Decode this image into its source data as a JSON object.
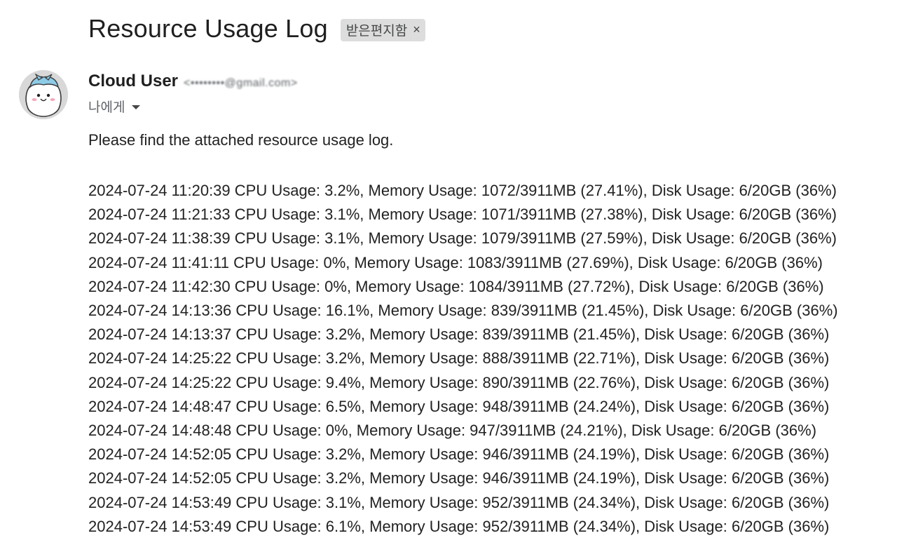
{
  "email": {
    "subject": "Resource Usage Log",
    "label_chip": {
      "label": "받은편지함",
      "close": "×"
    },
    "sender": {
      "name": "Cloud User",
      "email": "<••••••••@gmail.com>"
    },
    "recipient_line": "나에게",
    "body_intro": "Please find the attached resource usage log.",
    "log_lines": [
      "2024-07-24 11:20:39 CPU Usage: 3.2%, Memory Usage: 1072/3911MB (27.41%), Disk Usage: 6/20GB (36%)",
      "2024-07-24 11:21:33 CPU Usage: 3.1%, Memory Usage: 1071/3911MB (27.38%), Disk Usage: 6/20GB (36%)",
      "2024-07-24 11:38:39 CPU Usage: 3.1%, Memory Usage: 1079/3911MB (27.59%), Disk Usage: 6/20GB (36%)",
      "2024-07-24 11:41:11 CPU Usage: 0%, Memory Usage: 1083/3911MB (27.69%), Disk Usage: 6/20GB (36%)",
      "2024-07-24 11:42:30 CPU Usage: 0%, Memory Usage: 1084/3911MB (27.72%), Disk Usage: 6/20GB (36%)",
      "2024-07-24 14:13:36 CPU Usage: 16.1%, Memory Usage: 839/3911MB (21.45%), Disk Usage: 6/20GB (36%)",
      "2024-07-24 14:13:37 CPU Usage: 3.2%, Memory Usage: 839/3911MB (21.45%), Disk Usage: 6/20GB (36%)",
      "2024-07-24 14:25:22 CPU Usage: 3.2%, Memory Usage: 888/3911MB (22.71%), Disk Usage: 6/20GB (36%)",
      "2024-07-24 14:25:22 CPU Usage: 9.4%, Memory Usage: 890/3911MB (22.76%), Disk Usage: 6/20GB (36%)",
      "2024-07-24 14:48:47 CPU Usage: 6.5%, Memory Usage: 948/3911MB (24.24%), Disk Usage: 6/20GB (36%)",
      "2024-07-24 14:48:48 CPU Usage: 0%, Memory Usage: 947/3911MB (24.21%), Disk Usage: 6/20GB (36%)",
      "2024-07-24 14:52:05 CPU Usage: 3.2%, Memory Usage: 946/3911MB (24.19%), Disk Usage: 6/20GB (36%)",
      "2024-07-24 14:52:05 CPU Usage: 3.2%, Memory Usage: 946/3911MB (24.19%), Disk Usage: 6/20GB (36%)",
      "2024-07-24 14:53:49 CPU Usage: 3.1%, Memory Usage: 952/3911MB (24.34%), Disk Usage: 6/20GB (36%)",
      "2024-07-24 14:53:49 CPU Usage: 6.1%, Memory Usage: 952/3911MB (24.34%), Disk Usage: 6/20GB (36%)"
    ]
  },
  "icons": {
    "avatar": "cartoon-character-avatar",
    "recipient_caret": "caret-down-icon",
    "chip_close": "close-icon"
  }
}
